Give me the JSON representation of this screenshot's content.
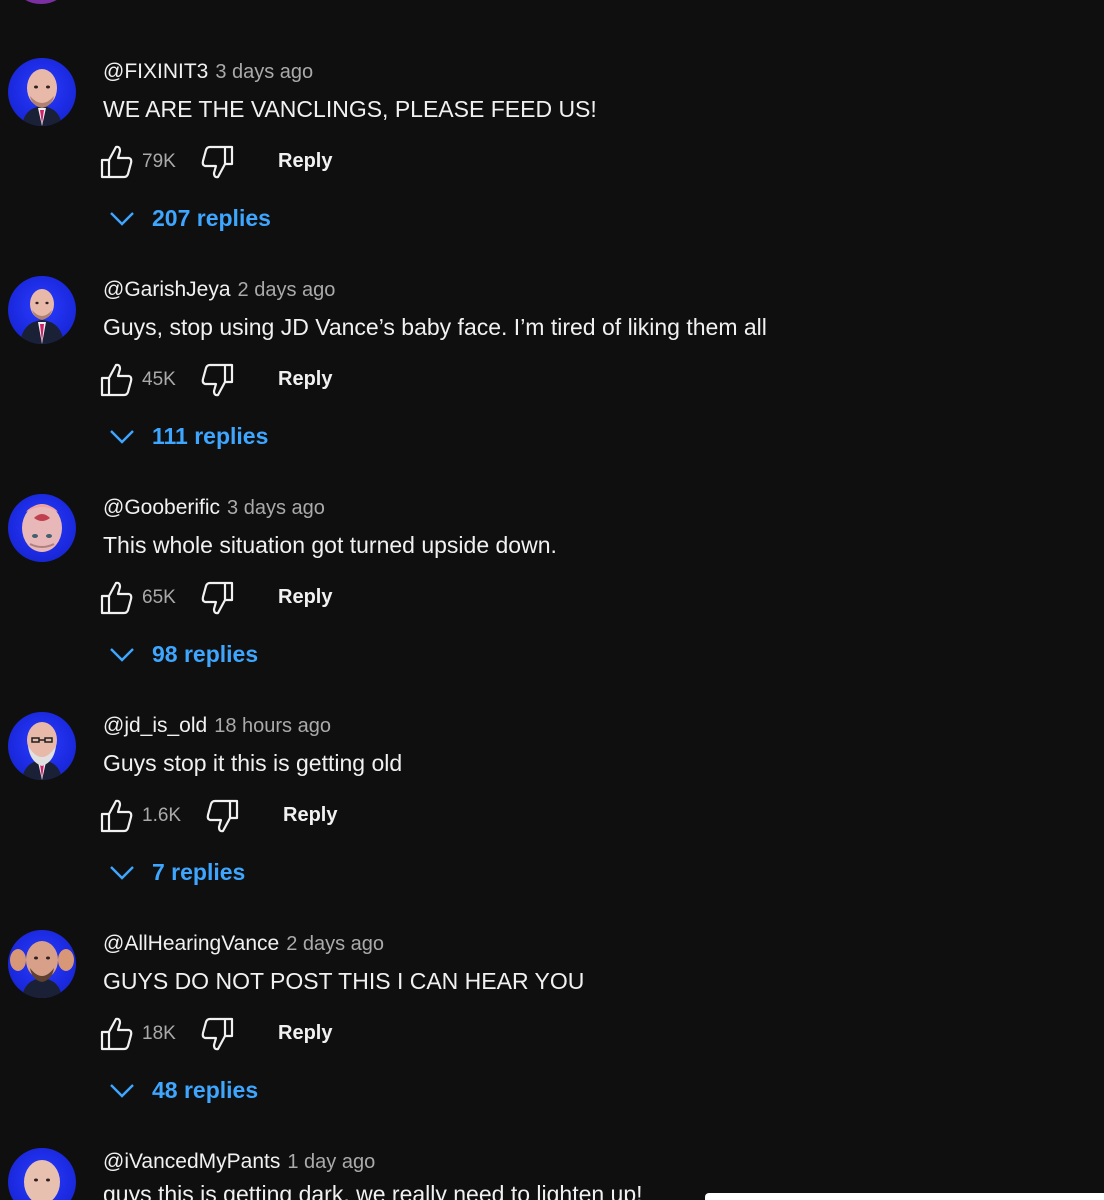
{
  "comments": [
    {
      "author": "@FIXINIT3",
      "time": "3 days ago",
      "text": "WE ARE THE VANCLINGS, PLEASE FEED US!",
      "likes": "79K",
      "reply_label": "Reply",
      "replies_label": "207 replies"
    },
    {
      "author": "@GarishJeya",
      "time": "2 days ago",
      "text": "Guys, stop using JD Vance’s baby face. I’m tired of liking them all",
      "likes": "45K",
      "reply_label": "Reply",
      "replies_label": "111 replies"
    },
    {
      "author": "@Gooberific",
      "time": "3 days ago",
      "text": "This whole situation got turned upside down.",
      "likes": "65K",
      "reply_label": "Reply",
      "replies_label": "98 replies"
    },
    {
      "author": "@jd_is_old",
      "time": "18 hours ago",
      "text": "Guys stop it this is getting old",
      "likes": "1.6K",
      "reply_label": "Reply",
      "replies_label": "7 replies"
    },
    {
      "author": "@AllHearingVance",
      "time": "2 days ago",
      "text": "GUYS DO NOT POST THIS I CAN HEAR YOU",
      "likes": "18K",
      "reply_label": "Reply",
      "replies_label": "48 replies"
    },
    {
      "author": "@iVancedMyPants",
      "time": "1 day ago",
      "text": "guys this is getting dark, we really need to lighten up!"
    }
  ],
  "colors": {
    "background": "#0f0f0f",
    "text": "#f1f1f1",
    "secondary_text": "#aaaaaa",
    "replies_accent": "#3ea6ff",
    "avatar_background": "#1b2ae0"
  },
  "icons": {
    "like": "thumbs-up-icon",
    "dislike": "thumbs-down-icon",
    "expand": "chevron-down-icon",
    "avatar": "avatar-image"
  }
}
